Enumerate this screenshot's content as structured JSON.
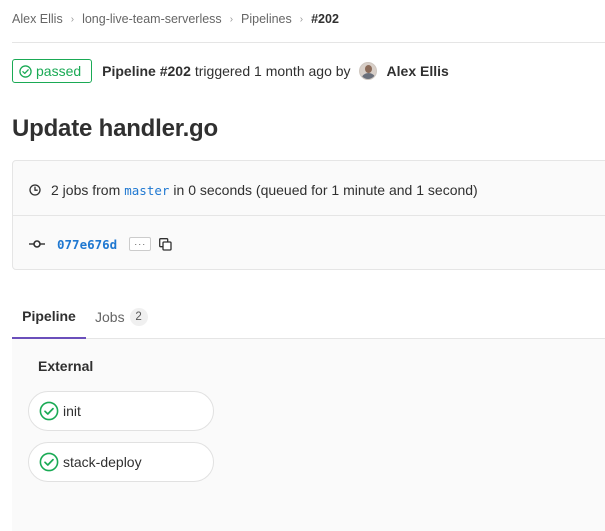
{
  "breadcrumb": {
    "items": [
      "Alex Ellis",
      "long-live-team-serverless",
      "Pipelines"
    ],
    "current": "#202"
  },
  "header": {
    "status": "passed",
    "pipeline_id": "Pipeline #202",
    "triggered_text": "triggered 1 month ago by",
    "author": "Alex Ellis"
  },
  "title": "Update handler.go",
  "info": {
    "jobs_prefix": "2 jobs from",
    "branch": "master",
    "jobs_suffix": "in 0 seconds (queued for 1 minute and 1 second)",
    "sha": "077e676d",
    "ellipsis": "···"
  },
  "tabs": {
    "pipeline": "Pipeline",
    "jobs": "Jobs",
    "jobs_count": "2"
  },
  "graph": {
    "stage": "External",
    "jobs": [
      "init",
      "stack-deploy"
    ]
  },
  "colors": {
    "success": "#1aaa55",
    "link": "#1f78d1",
    "tab_active": "#6b4fbb"
  },
  "icons": {
    "status": "check-circle-icon",
    "clock": "clock-icon",
    "commit": "commit-icon",
    "copy": "copy-icon",
    "separator": "chevron-right-icon"
  }
}
